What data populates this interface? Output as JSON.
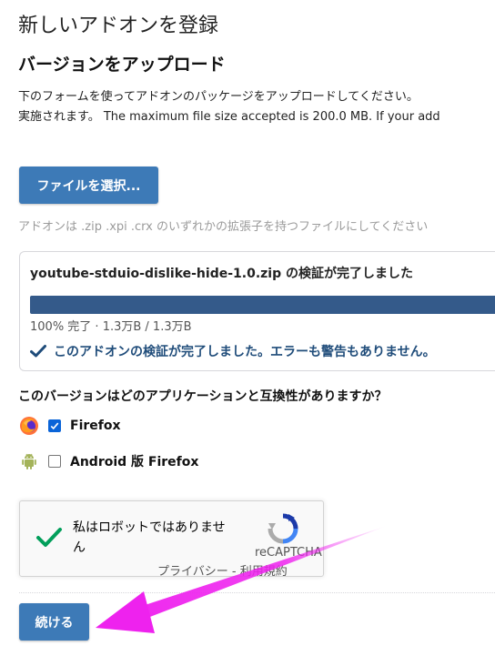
{
  "page": {
    "title": "新しいアドオンを登録",
    "subtitle": "バージョンをアップロード",
    "intro_line1": "下のフォームを使ってアドオンのパッケージをアップロードしてください。",
    "intro_line2": "実施されます。 The maximum file size accepted is 200.0 MB. If your add"
  },
  "upload": {
    "file_button_label": "ファイルを選択...",
    "hint": "アドオンは .zip .xpi .crx のいずれかの拡張子を持つファイルにしてください"
  },
  "validation": {
    "filename_message": "youtube-stduio-dislike-hide-1.0.zip の検証が完了しました",
    "progress_percent": 100,
    "progress_text": "100% 完了 · 1.3万B / 1.3万B",
    "success_message": "このアドオンの検証が完了しました。エラーも警告もありません。",
    "progress_color": "#345a8a"
  },
  "compatibility": {
    "question": "このバージョンはどのアプリケーションと互換性がありますか？",
    "apps": [
      {
        "label": "Firefox",
        "checked": true,
        "icon": "firefox-icon"
      },
      {
        "label": "Android 版 Firefox",
        "checked": false,
        "icon": "android-icon"
      }
    ]
  },
  "captcha": {
    "label": "私はロボットではありません",
    "brand": "reCAPTCHA",
    "links": "プライバシー - 利用規約"
  },
  "actions": {
    "continue_label": "続ける"
  },
  "colors": {
    "button": "#3d7ab7",
    "annotation_arrow": "#ee22ee"
  }
}
